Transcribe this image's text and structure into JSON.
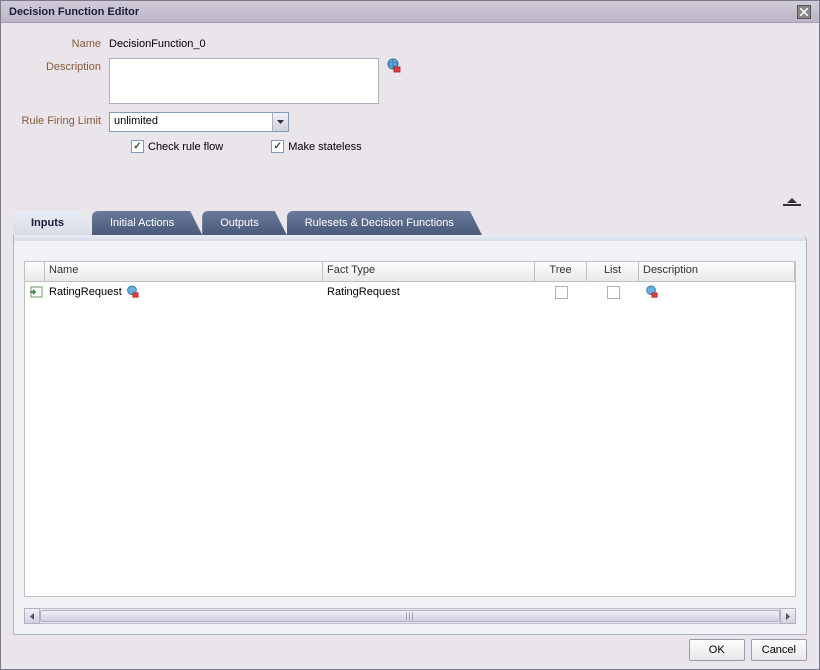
{
  "window": {
    "title": "Decision Function Editor"
  },
  "form": {
    "name_label": "Name",
    "name_value": "DecisionFunction_0",
    "description_label": "Description",
    "description_value": "",
    "rule_firing_limit_label": "Rule Firing Limit",
    "rule_firing_limit_value": "unlimited",
    "check_rule_flow_label": "Check rule flow",
    "check_rule_flow_checked": true,
    "make_stateless_label": "Make stateless",
    "make_stateless_checked": true
  },
  "tabs": {
    "items": [
      {
        "label": "Inputs",
        "active": true
      },
      {
        "label": "Initial Actions",
        "active": false
      },
      {
        "label": "Outputs",
        "active": false
      },
      {
        "label": "Rulesets & Decision Functions",
        "active": false
      }
    ]
  },
  "grid": {
    "headers": {
      "name": "Name",
      "fact_type": "Fact Type",
      "tree": "Tree",
      "list": "List",
      "description": "Description"
    },
    "rows": [
      {
        "name": "RatingRequest",
        "fact_type": "RatingRequest",
        "tree_checked": false,
        "list_checked": false,
        "description": ""
      }
    ]
  },
  "buttons": {
    "ok": "OK",
    "cancel": "Cancel"
  }
}
